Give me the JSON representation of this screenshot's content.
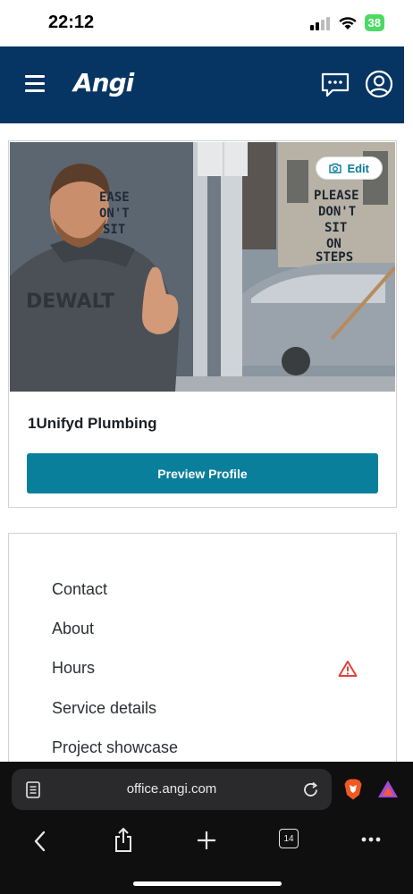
{
  "status_bar": {
    "time": "22:12",
    "battery": "38"
  },
  "header": {
    "logo": "Angi",
    "brand_color": "#063563"
  },
  "profile_card": {
    "edit_label": "Edit",
    "business_name": "1Unifyd Plumbing",
    "preview_button_label": "Preview Profile",
    "photo_signs": [
      "PLEASE",
      "DON'T",
      "SIT",
      "ON",
      "STEPS"
    ],
    "left_sign": [
      "EASE",
      "ON'T",
      "SIT"
    ],
    "hoodie_text": "DEWALT",
    "accent_color": "#0a7f9c"
  },
  "menu": {
    "items": [
      {
        "label": "Contact"
      },
      {
        "label": "About"
      },
      {
        "label": "Hours",
        "warning": true
      },
      {
        "label": "Service details"
      },
      {
        "label": "Project showcase"
      }
    ],
    "warning_color": "#e0413a"
  },
  "browser": {
    "url": "office.angi.com",
    "tab_count": "14"
  }
}
